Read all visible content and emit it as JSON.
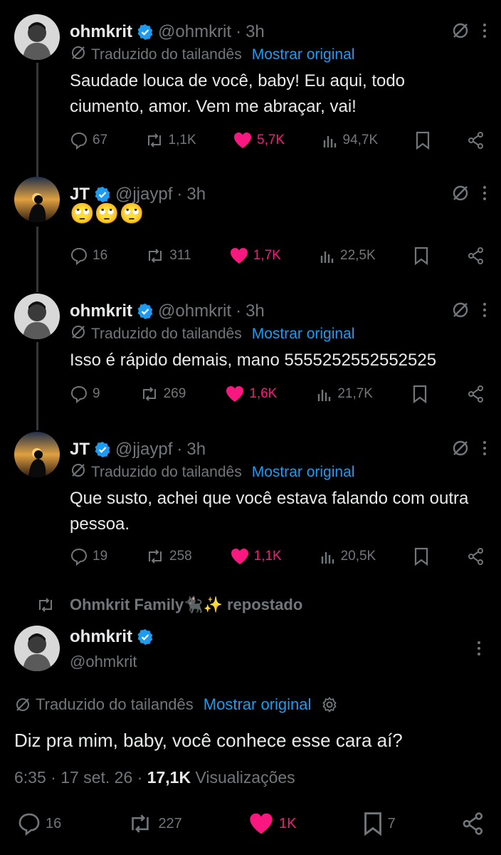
{
  "translation": {
    "label": "Traduzido do tailandês",
    "show_original": "Mostrar original"
  },
  "tweets": [
    {
      "name": "ohmkrit",
      "handle": "@ohmkrit",
      "time": "3h",
      "text": "Saudade louca de você, baby! Eu aqui, todo ciumento, amor. Vem me abraçar, vai!",
      "replies": "67",
      "reposts": "1,1K",
      "likes": "5,7K",
      "views": "94,7K"
    },
    {
      "name": "JT",
      "handle": "@jjaypf",
      "time": "3h",
      "text": "🙄🙄🙄",
      "replies": "16",
      "reposts": "311",
      "likes": "1,7K",
      "views": "22,5K"
    },
    {
      "name": "ohmkrit",
      "handle": "@ohmkrit",
      "time": "3h",
      "text": "Isso é rápido demais, mano 5555252552552525",
      "replies": "9",
      "reposts": "269",
      "likes": "1,6K",
      "views": "21,7K"
    },
    {
      "name": "JT",
      "handle": "@jjaypf",
      "time": "3h",
      "text": "Que susto, achei que você estava falando com outra pessoa.",
      "replies": "19",
      "reposts": "258",
      "likes": "1,1K",
      "views": "20,5K"
    }
  ],
  "repost_bar": {
    "who": "Ohmkrit Family🐈‍⬛✨",
    "label": "repostado"
  },
  "main": {
    "name": "ohmkrit",
    "handle": "@ohmkrit",
    "text": "Diz pra mim, baby, você conhece esse cara aí?",
    "time": "6:35",
    "date": "17 set. 26",
    "views": "17,1K",
    "views_label": "Visualizações",
    "replies": "16",
    "reposts": "227",
    "likes": "1K",
    "bookmarks": "7"
  },
  "colors": {
    "accent": "#1d9bf0",
    "like": "#f91880",
    "muted": "#71767b"
  }
}
